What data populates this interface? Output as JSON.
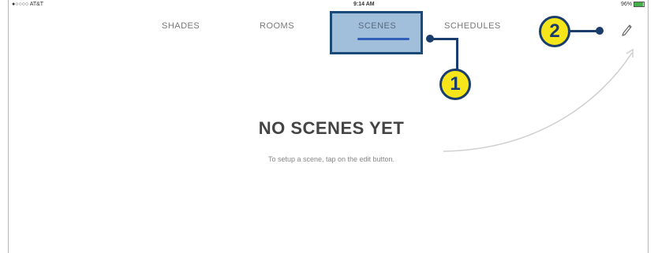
{
  "statusbar": {
    "carrier": "●○○○○ AT&T",
    "time": "9:14 AM",
    "battery": "96%"
  },
  "tabs": [
    {
      "label": "SHADES"
    },
    {
      "label": "ROOMS"
    },
    {
      "label": "SCENES",
      "selected": true
    },
    {
      "label": "SCHEDULES"
    }
  ],
  "callouts": [
    {
      "number": "1"
    },
    {
      "number": "2"
    }
  ],
  "empty_state": {
    "title": "NO SCENES YET",
    "subtitle": "To setup a scene, tap on the edit button."
  },
  "icons": {
    "edit": "pencil-icon",
    "wifi": "wifi-icon",
    "battery": "battery-icon"
  },
  "colors": {
    "callout_fill": "#f5e51a",
    "callout_border": "#1a3d6b",
    "highlight": "#82aacd",
    "tab_underline": "#2f5fb8"
  }
}
